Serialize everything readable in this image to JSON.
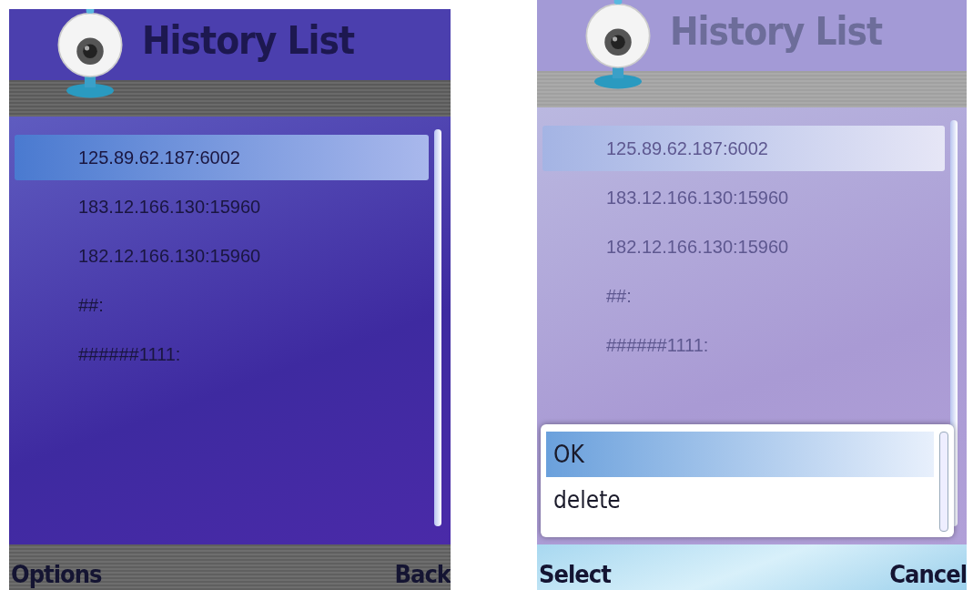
{
  "screens": [
    {
      "title": "History List",
      "dimmed": false,
      "items": [
        {
          "label": "125.89.62.187:6002",
          "selected": true
        },
        {
          "label": "183.12.166.130:15960",
          "selected": false
        },
        {
          "label": "182.12.166.130:15960",
          "selected": false
        },
        {
          "label": "##:",
          "selected": false
        },
        {
          "label": "######1111:",
          "selected": false
        }
      ],
      "softkeys": {
        "left": "Options",
        "right": "Back"
      }
    },
    {
      "title": "History List",
      "dimmed": true,
      "items": [
        {
          "label": "125.89.62.187:6002",
          "selected": true
        },
        {
          "label": "183.12.166.130:15960",
          "selected": false
        },
        {
          "label": "182.12.166.130:15960",
          "selected": false
        },
        {
          "label": "##:",
          "selected": false
        },
        {
          "label": "######1111:",
          "selected": false
        }
      ],
      "menu": {
        "items": [
          {
            "label": "OK",
            "selected": true
          },
          {
            "label": "delete",
            "selected": false
          }
        ]
      },
      "softkeys": {
        "left": "Select",
        "right": "Cancel"
      }
    }
  ]
}
